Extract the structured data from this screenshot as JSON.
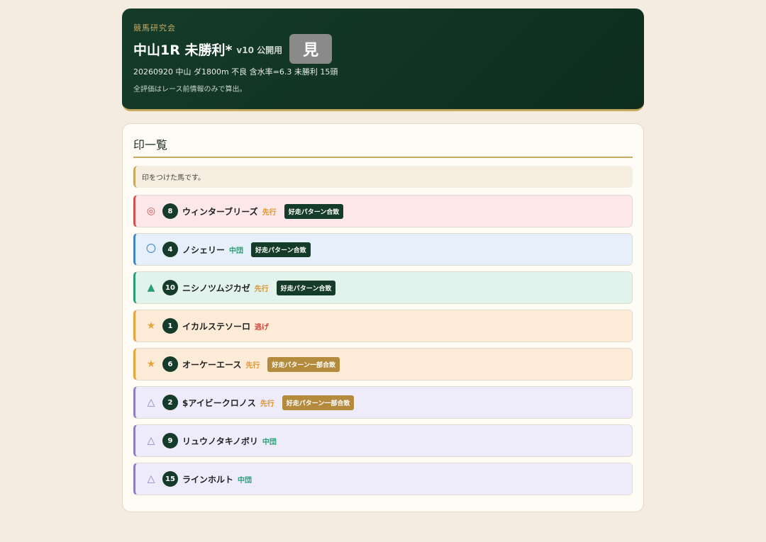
{
  "header": {
    "org": "競馬研究会",
    "title": "中山1R 未勝利*",
    "version": "v10 公開用",
    "view_button": "見",
    "race_info": "20260920 中山 ダ1800m 不良 含水率=6.3 未勝利 15頭",
    "note": "全評価はレース前情報のみで算出。"
  },
  "section": {
    "title": "印一覧",
    "info": "印をつけた馬です。"
  },
  "colors": {
    "honmei": "#d45050",
    "taikou": "#3f86c9",
    "tanana": "#2a9d76",
    "hoshi": "#e8a23a",
    "renka": "#8a7ec6",
    "senko": "#e0932c",
    "chudan": "#2a9d76",
    "nige": "#d4453f"
  },
  "horses": [
    {
      "mark": "◎",
      "num": "8",
      "name": "ウィンターブリーズ",
      "style": "先行",
      "badge": "好走パターン合致",
      "badge_type": "dark",
      "theme": "honmei",
      "style_key": "senko"
    },
    {
      "mark": "〇",
      "num": "4",
      "name": "ノシェリー",
      "style": "中団",
      "badge": "好走パターン合致",
      "badge_type": "dark",
      "theme": "taikou",
      "style_key": "chudan"
    },
    {
      "mark": "▲",
      "num": "10",
      "name": "ニシノツムジカゼ",
      "style": "先行",
      "badge": "好走パターン合致",
      "badge_type": "dark",
      "theme": "tanana",
      "style_key": "senko"
    },
    {
      "mark": "★",
      "num": "1",
      "name": "イカルステソーロ",
      "style": "逃げ",
      "badge": "",
      "badge_type": "",
      "theme": "hoshi",
      "style_key": "nige"
    },
    {
      "mark": "★",
      "num": "6",
      "name": "オーケーエース",
      "style": "先行",
      "badge": "好走パターン一部合致",
      "badge_type": "gold",
      "theme": "hoshi",
      "style_key": "senko"
    },
    {
      "mark": "△",
      "num": "2",
      "name": "$アイビークロノス",
      "style": "先行",
      "badge": "好走パターン一部合致",
      "badge_type": "gold",
      "theme": "renka",
      "style_key": "senko"
    },
    {
      "mark": "△",
      "num": "9",
      "name": "リュウノタキノボリ",
      "style": "中団",
      "badge": "",
      "badge_type": "",
      "theme": "renka",
      "style_key": "chudan"
    },
    {
      "mark": "△",
      "num": "15",
      "name": "ラインホルト",
      "style": "中団",
      "badge": "",
      "badge_type": "",
      "theme": "renka",
      "style_key": "chudan"
    }
  ]
}
